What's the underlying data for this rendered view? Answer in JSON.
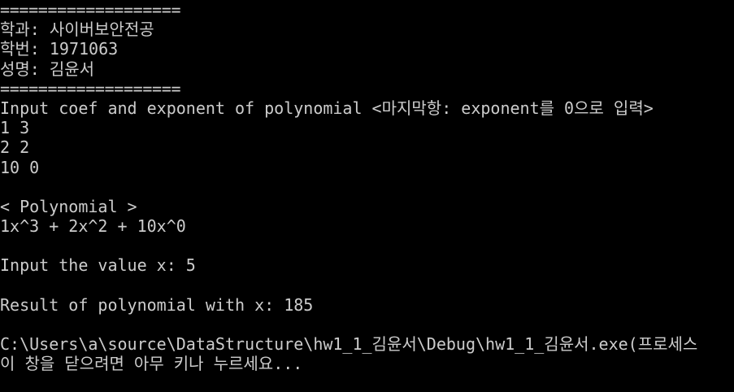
{
  "colors": {
    "background": "#000000",
    "text": "#cccccc"
  },
  "console": {
    "lines": [
      "===================",
      "학과: 사이버보안전공",
      "학번: 1971063",
      "성명: 김윤서",
      "===================",
      "Input coef and exponent of polynomial <마지막항: exponent를 0으로 입력>",
      "1 3",
      "2 2",
      "10 0",
      "",
      "< Polynomial >",
      "1x^3 + 2x^2 + 10x^0",
      "",
      "Input the value x: 5",
      "",
      "Result of polynomial with x: 185",
      "",
      "C:\\Users\\a\\source\\DataStructure\\hw1_1_김윤서\\Debug\\hw1_1_김윤서.exe(프로세스",
      "이 창을 닫으려면 아무 키나 누르세요..."
    ]
  }
}
